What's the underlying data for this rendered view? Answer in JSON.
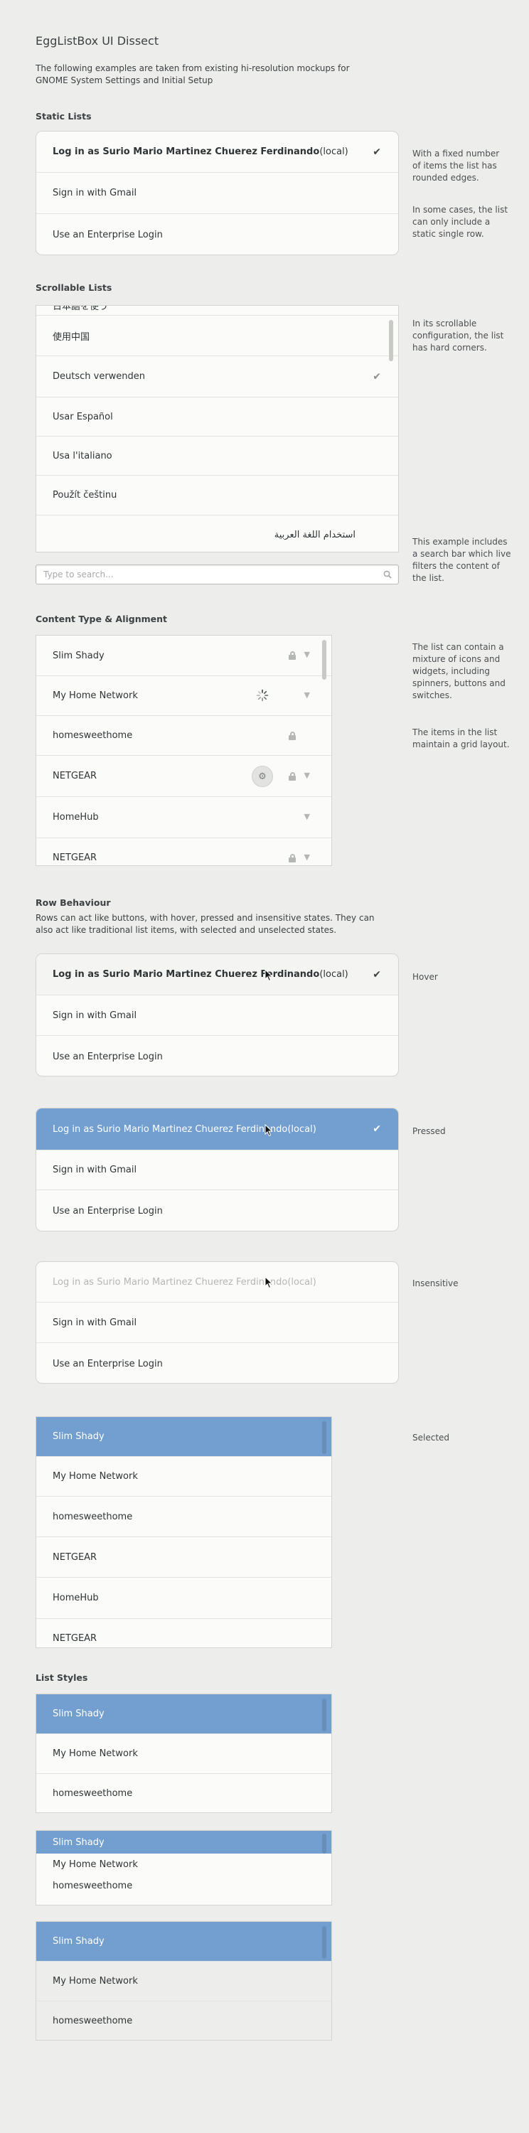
{
  "header": {
    "title": "EggListBox UI Dissect",
    "intro_line1": "The following examples are taken from existing hi-resolution mockups for",
    "intro_line2": "GNOME System Settings and Initial Setup"
  },
  "static_lists": {
    "heading": "Static Lists",
    "rows": [
      {
        "bold": "Log in as Surio Mario Martinez Chuerez Ferdinando",
        "rest": " (local)",
        "checked": true
      },
      {
        "bold": "",
        "rest": "Sign in with Gmail",
        "checked": false
      },
      {
        "bold": "",
        "rest": "Use an Enterprise Login",
        "checked": false
      }
    ],
    "side_note_1": [
      "With a fixed number",
      "of items the list has",
      "rounded edges."
    ],
    "side_note_2": [
      "In some cases, the list",
      "can only include a",
      "static single row."
    ]
  },
  "scrollable_lists": {
    "heading": "Scrollable Lists",
    "rows": [
      "日本語を使う",
      "使用中国",
      "Deutsch verwenden",
      "Usar Español",
      "Usa l'italiano",
      "Použít češtinu",
      "استخدام اللغة العربية"
    ],
    "checked_row": "Deutsch verwenden",
    "search_placeholder": "Type to search...",
    "side_note_1": [
      "In its scrollable",
      "configuration, the list",
      "has hard corners."
    ],
    "side_note_2": [
      "This example includes",
      "a search bar which live",
      "filters the content of",
      "the list."
    ]
  },
  "content_type": {
    "heading": "Content Type & Alignment",
    "rows": [
      "Slim Shady",
      "My Home Network",
      "homesweethome",
      "NETGEAR",
      "HomeHub",
      "NETGEAR"
    ],
    "side_note_1": [
      "The list can contain a",
      "mixture of icons and",
      "widgets, including",
      "spinners, buttons and",
      "switches."
    ],
    "side_note_2": [
      "The items in the list",
      "maintain a grid layout."
    ]
  },
  "row_behaviour": {
    "heading": "Row Behaviour",
    "desc_line1": "Rows can act like buttons, with hover, pressed and insensitive states. They can",
    "desc_line2": "also act like traditional list items, with selected and unselected states.",
    "rows": [
      {
        "bold": "Log in as Surio Mario Martinez Chuerez Ferdinando",
        "rest": " (local)"
      },
      {
        "bold": "",
        "rest": "Sign in with Gmail"
      },
      {
        "bold": "",
        "rest": "Use an Enterprise Login"
      }
    ],
    "label_hover": "Hover",
    "label_pressed": "Pressed",
    "label_insensitive": "Insensitive",
    "label_selected": "Selected",
    "selected_rows": [
      "Slim Shady",
      "My Home Network",
      "homesweethome",
      "NETGEAR",
      "HomeHub",
      "NETGEAR"
    ]
  },
  "list_styles": {
    "heading": "List Styles",
    "rows": [
      "Slim Shady",
      "My Home Network",
      "homesweethome"
    ]
  },
  "colors": {
    "accent": "#729fcf",
    "background": "#ededeb",
    "list_bg": "#fbfbfa"
  }
}
